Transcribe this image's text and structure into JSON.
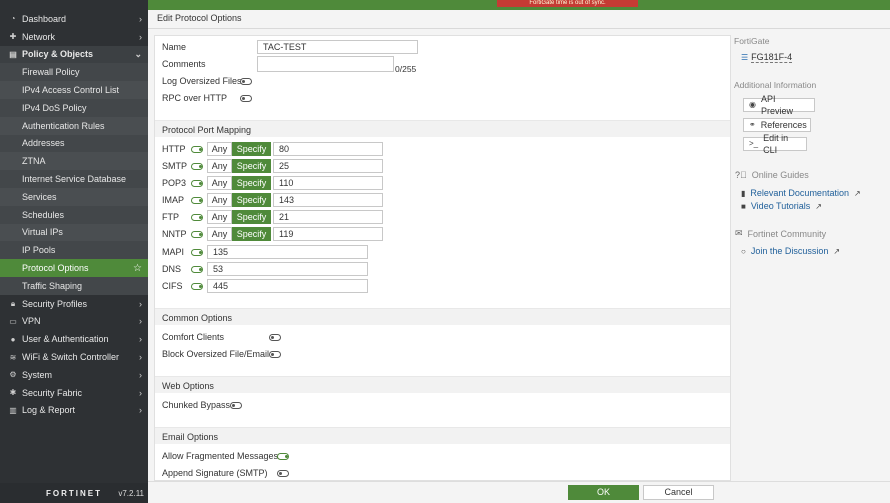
{
  "nav": {
    "items": [
      {
        "label": "Dashboard",
        "icon": "gauge-icon"
      },
      {
        "label": "Network",
        "icon": "plus-cross-icon"
      },
      {
        "label": "Policy & Objects",
        "icon": "document-icon"
      },
      {
        "label": "Firewall Policy"
      },
      {
        "label": "IPv4 Access Control List"
      },
      {
        "label": "IPv4 DoS Policy"
      },
      {
        "label": "Authentication Rules"
      },
      {
        "label": "Addresses"
      },
      {
        "label": "ZTNA"
      },
      {
        "label": "Internet Service Database"
      },
      {
        "label": "Services"
      },
      {
        "label": "Schedules"
      },
      {
        "label": "Virtual IPs"
      },
      {
        "label": "IP Pools"
      },
      {
        "label": "Protocol Options"
      },
      {
        "label": "Traffic Shaping"
      },
      {
        "label": "Security Profiles",
        "icon": "lock-icon"
      },
      {
        "label": "VPN",
        "icon": "laptop-icon"
      },
      {
        "label": "User & Authentication",
        "icon": "user-icon"
      },
      {
        "label": "WiFi & Switch Controller",
        "icon": "wifi-icon"
      },
      {
        "label": "System",
        "icon": "gear-icon"
      },
      {
        "label": "Security Fabric",
        "icon": "asterisk-icon"
      },
      {
        "label": "Log & Report",
        "icon": "chart-icon"
      }
    ],
    "brand": "FORTINET",
    "version": "v7.2.11"
  },
  "alert_text": "FortiGate time is out of sync.",
  "page_title": "Edit Protocol Options",
  "form": {
    "name_label": "Name",
    "name_value": "TAC-TEST",
    "comments_label": "Comments",
    "comments_count": "0/255",
    "log_oversized_label": "Log Oversized Files",
    "rpc_label": "RPC over HTTP",
    "ppm_title": "Protocol Port Mapping",
    "any_label": "Any",
    "specify_label": "Specify",
    "protocols": [
      {
        "label": "HTTP",
        "port": "80",
        "enabled": true
      },
      {
        "label": "SMTP",
        "port": "25",
        "enabled": true
      },
      {
        "label": "POP3",
        "port": "110",
        "enabled": true
      },
      {
        "label": "IMAP",
        "port": "143",
        "enabled": true
      },
      {
        "label": "FTP",
        "port": "21",
        "enabled": true
      },
      {
        "label": "NNTP",
        "port": "119",
        "enabled": true
      },
      {
        "label": "MAPI",
        "port": "135",
        "enabled": true
      },
      {
        "label": "DNS",
        "port": "53",
        "enabled": true
      },
      {
        "label": "CIFS",
        "port": "445",
        "enabled": true
      }
    ],
    "common_title": "Common Options",
    "comfort_label": "Comfort Clients",
    "block_oversized_label": "Block Oversized File/Email",
    "web_title": "Web Options",
    "chunked_label": "Chunked Bypass",
    "email_title": "Email Options",
    "allow_frag_label": "Allow Fragmented Messages",
    "append_sig_label": "Append Signature (SMTP)"
  },
  "right": {
    "fortigate_label": "FortiGate",
    "device_name": "FG181F-4",
    "additional_label": "Additional Information",
    "api_preview": "API Preview",
    "references": "References",
    "edit_cli": "Edit in CLI",
    "online_guides": "Online Guides",
    "relevant_docs": "Relevant Documentation",
    "video_tutorials": "Video Tutorials",
    "community": "Fortinet Community",
    "join_discussion": "Join the Discussion"
  },
  "footer": {
    "ok": "OK",
    "cancel": "Cancel"
  },
  "colors": {
    "accent": "#4f8a3a",
    "sidebar": "#2e3134",
    "alert": "#c53b34",
    "link": "#1f5f9a"
  }
}
